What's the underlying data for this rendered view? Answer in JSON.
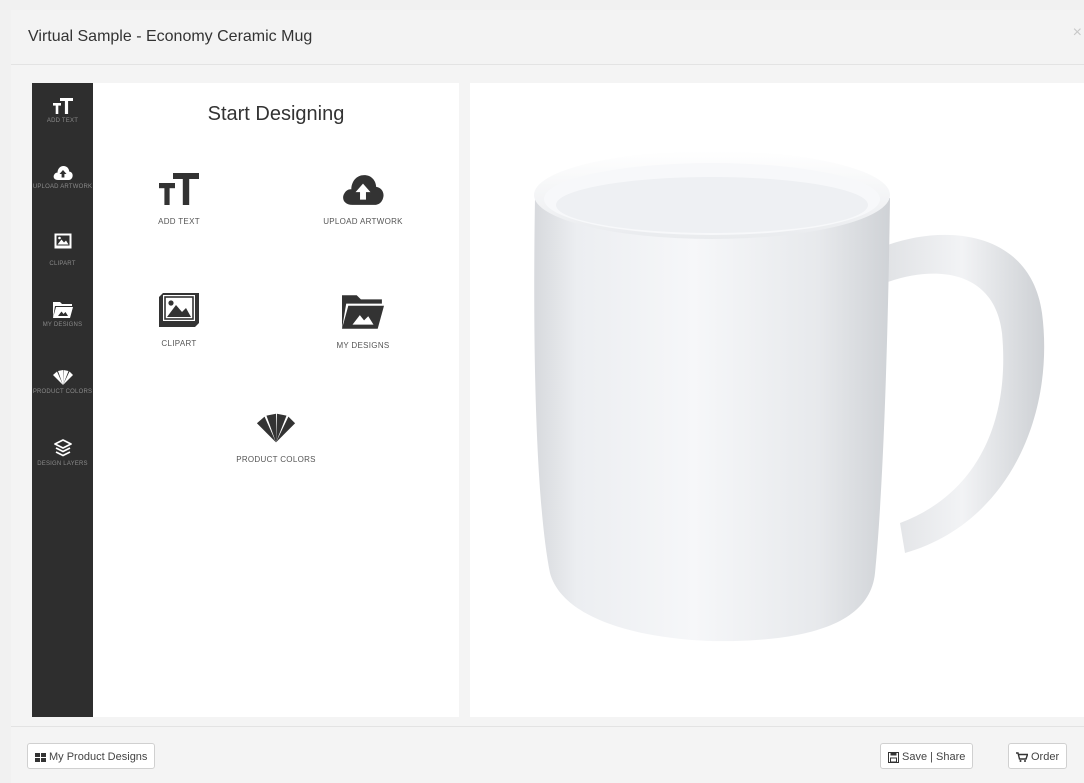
{
  "window": {
    "title": "Virtual Sample - Economy Ceramic Mug",
    "close_label": "×"
  },
  "sidebar": {
    "items": [
      {
        "icon": "text-size-icon",
        "label": "ADD TEXT"
      },
      {
        "icon": "cloud-upload-icon",
        "label": "UPLOAD ARTWORK"
      },
      {
        "icon": "image-icon",
        "label": "CLIPART"
      },
      {
        "icon": "folder-image-icon",
        "label": "MY DESIGNS"
      },
      {
        "icon": "color-swatch-icon",
        "label": "PRODUCT COLORS"
      },
      {
        "icon": "layers-icon",
        "label": "DESIGN LAYERS"
      }
    ]
  },
  "panel": {
    "title": "Start Designing",
    "options": [
      {
        "icon": "text-size-icon",
        "label": "ADD TEXT"
      },
      {
        "icon": "cloud-upload-icon",
        "label": "UPLOAD ARTWORK"
      },
      {
        "icon": "image-icon",
        "label": "CLIPART"
      },
      {
        "icon": "folder-image-icon",
        "label": "MY DESIGNS"
      },
      {
        "icon": "color-swatch-icon",
        "label": "PRODUCT COLORS"
      }
    ]
  },
  "preview": {
    "product": "white ceramic mug"
  },
  "footer": {
    "my_designs_label": "My Product Designs",
    "save_share_label": "Save | Share",
    "order_label": "Order"
  },
  "colors": {
    "sidebar_bg": "#2e2e2e",
    "icon_dark": "#333333",
    "panel_bg": "#ffffff"
  }
}
